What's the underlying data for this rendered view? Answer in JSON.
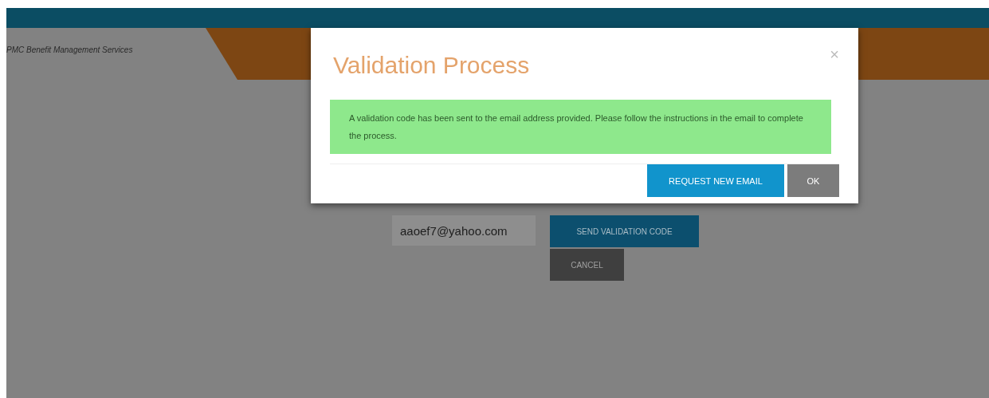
{
  "header": {
    "brand": "PMC Benefit Management Services"
  },
  "form": {
    "email_value": "aaoef7@yahoo.com",
    "send_button": "SEND VALIDATION CODE",
    "cancel_button": "CANCEL"
  },
  "modal": {
    "title": "Validation Process",
    "close": "×",
    "message": "A validation code has been sent to the email address provided. Please follow the instructions in the email to complete the process.",
    "buttons": [
      {
        "label": "REQUEST NEW EMAIL",
        "kind": "primary"
      },
      {
        "label": "OK",
        "kind": "secondary"
      }
    ]
  }
}
